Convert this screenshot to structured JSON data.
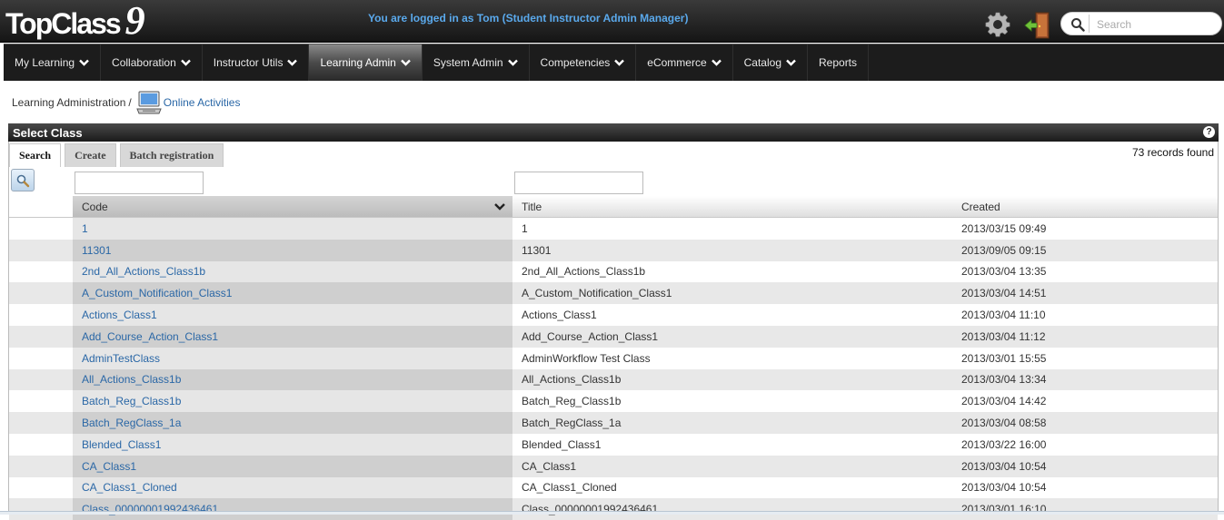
{
  "header": {
    "logo_text": "TopClass",
    "logo_version": "9",
    "login_text": "You are logged in as Tom (Student Instructor Admin Manager)",
    "search_placeholder": "Search"
  },
  "nav": {
    "items": [
      {
        "label": "My Learning",
        "dropdown": true,
        "active": false
      },
      {
        "label": "Collaboration",
        "dropdown": true,
        "active": false
      },
      {
        "label": "Instructor Utils",
        "dropdown": true,
        "active": false
      },
      {
        "label": "Learning Admin",
        "dropdown": true,
        "active": true
      },
      {
        "label": "System Admin",
        "dropdown": true,
        "active": false
      },
      {
        "label": "Competencies",
        "dropdown": true,
        "active": false
      },
      {
        "label": "eCommerce",
        "dropdown": true,
        "active": false
      },
      {
        "label": "Catalog",
        "dropdown": true,
        "active": false
      },
      {
        "label": "Reports",
        "dropdown": false,
        "active": false
      }
    ]
  },
  "breadcrumb": {
    "home": "Learning Administration",
    "separator": "/",
    "current": "Online Activities"
  },
  "panel": {
    "title": "Select Class",
    "help": "?",
    "tabs": [
      "Search",
      "Create",
      "Batch registration"
    ],
    "records": "73 records found"
  },
  "table": {
    "headers": {
      "code": "Code",
      "title": "Title",
      "created": "Created"
    },
    "rows": [
      {
        "code": "1",
        "title": "1",
        "created": "2013/03/15 09:49"
      },
      {
        "code": "11301",
        "title": "11301",
        "created": "2013/09/05 09:15"
      },
      {
        "code": "2nd_All_Actions_Class1b",
        "title": "2nd_All_Actions_Class1b",
        "created": "2013/03/04 13:35"
      },
      {
        "code": "A_Custom_Notification_Class1",
        "title": "A_Custom_Notification_Class1",
        "created": "2013/03/04 14:51"
      },
      {
        "code": "Actions_Class1",
        "title": "Actions_Class1",
        "created": "2013/03/04 11:10"
      },
      {
        "code": "Add_Course_Action_Class1",
        "title": "Add_Course_Action_Class1",
        "created": "2013/03/04 11:12"
      },
      {
        "code": "AdminTestClass",
        "title": "AdminWorkflow Test Class",
        "created": "2013/03/01 15:55"
      },
      {
        "code": "All_Actions_Class1b",
        "title": "All_Actions_Class1b",
        "created": "2013/03/04 13:34"
      },
      {
        "code": "Batch_Reg_Class1b",
        "title": "Batch_Reg_Class1b",
        "created": "2013/03/04 14:42"
      },
      {
        "code": "Batch_RegClass_1a",
        "title": "Batch_RegClass_1a",
        "created": "2013/03/04 08:58"
      },
      {
        "code": "Blended_Class1",
        "title": "Blended_Class1",
        "created": "2013/03/22 16:00"
      },
      {
        "code": "CA_Class1",
        "title": "CA_Class1",
        "created": "2013/03/04 10:54"
      },
      {
        "code": "CA_Class1_Cloned",
        "title": "CA_Class1_Cloned",
        "created": "2013/03/04 10:54"
      },
      {
        "code": "Class_00000001992436461",
        "title": "Class_00000001992436461",
        "created": "2013/03/01 16:10"
      }
    ]
  },
  "colors": {
    "link": "#2a67a6",
    "login_text": "#5aa9ec",
    "nav_bg": "#1c1c1c"
  },
  "icons": [
    "gear-icon",
    "logout-door-icon",
    "search-icon",
    "computer-icon",
    "help-icon",
    "magnifier-icon",
    "chevron-down-icon"
  ]
}
